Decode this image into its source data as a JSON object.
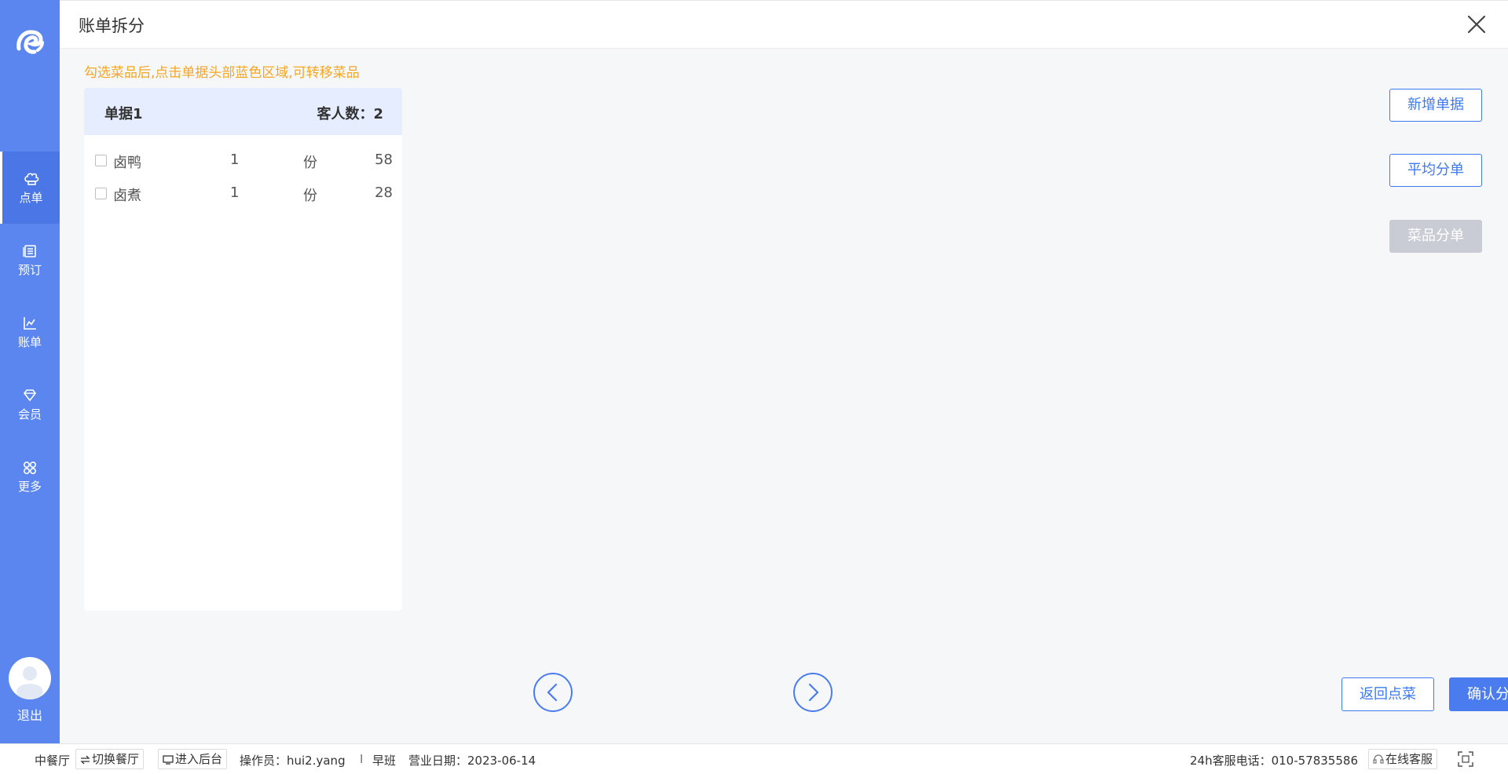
{
  "header": {
    "title": "账单拆分"
  },
  "sidebar": {
    "items": [
      {
        "label": "点单",
        "icon": "chef-hat-icon",
        "active": true
      },
      {
        "label": "预订",
        "icon": "booking-icon",
        "active": false
      },
      {
        "label": "账单",
        "icon": "chart-icon",
        "active": false
      },
      {
        "label": "会员",
        "icon": "diamond-icon",
        "active": false
      },
      {
        "label": "更多",
        "icon": "grid-icon",
        "active": false
      }
    ],
    "logout": "退出"
  },
  "main": {
    "hint": "勾选菜品后,点击单据头部蓝色区域,可转移菜品",
    "bill": {
      "name": "单据1",
      "guests": "客人数：2",
      "items": [
        {
          "name": "卤鸭",
          "qty": "1",
          "unit": "份",
          "price": "58"
        },
        {
          "name": "卤煮",
          "qty": "1",
          "unit": "份",
          "price": "28"
        }
      ]
    },
    "actions": {
      "add_bill": "新增单据",
      "avg_split": "平均分单",
      "dish_split": "菜品分单",
      "back": "返回点菜",
      "confirm": "确认分单"
    }
  },
  "footer": {
    "restaurant": "中餐厅",
    "switch": "切换餐厅",
    "backend": "进入后台",
    "operator": "操作员：hui2.yang",
    "separator": "I",
    "shift": "早班",
    "biz_date": "营业日期：2023-06-14",
    "hotline": "24h客服电话：010-57835586",
    "online_service": "在线客服"
  },
  "colors": {
    "primary": "#4a7cf0",
    "sidebar": "#5b86ef",
    "hint": "#f5a623",
    "bill_head": "#e6edfe"
  }
}
